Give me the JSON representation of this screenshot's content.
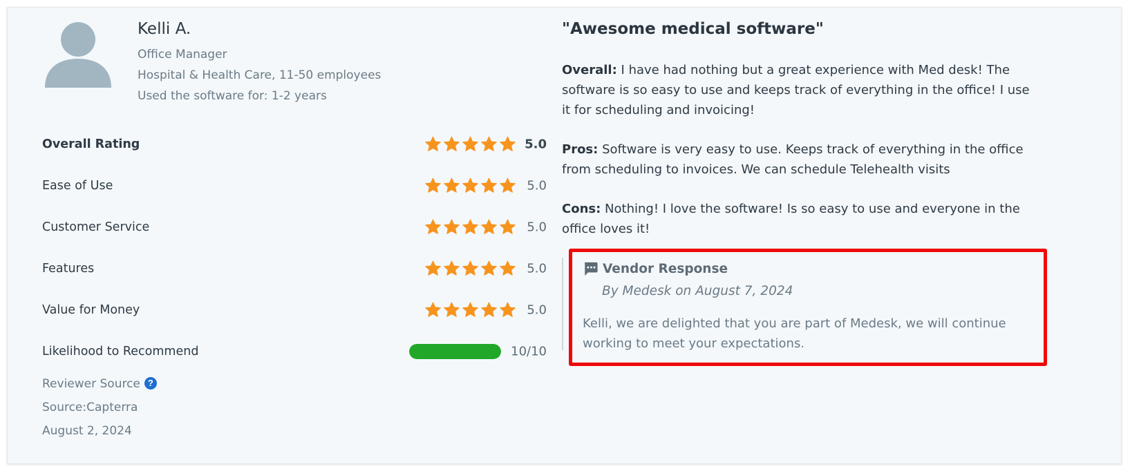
{
  "reviewer": {
    "name": "Kelli A.",
    "role": "Office Manager",
    "company": "Hospital & Health Care, 11-50 employees",
    "usage": "Used the software for: 1-2 years"
  },
  "ratings": [
    {
      "label": "Overall Rating",
      "stars": 5,
      "score": "5.0",
      "bold": true
    },
    {
      "label": "Ease of Use",
      "stars": 5,
      "score": "5.0",
      "bold": false
    },
    {
      "label": "Customer Service",
      "stars": 5,
      "score": "5.0",
      "bold": false
    },
    {
      "label": "Features",
      "stars": 5,
      "score": "5.0",
      "bold": false
    },
    {
      "label": "Value for Money",
      "stars": 5,
      "score": "5.0",
      "bold": false
    }
  ],
  "recommend": {
    "label": "Likelihood to Recommend",
    "value": 10,
    "max": 10,
    "text": "10/10"
  },
  "source": {
    "label": "Reviewer Source",
    "help_icon": "question-circle-icon",
    "source_text": "Source:Capterra",
    "date": "August 2, 2024"
  },
  "review": {
    "title": "\"Awesome medical software\"",
    "overall_label": "Overall:",
    "overall_text": " I have had nothing but a great experience with Med desk! The software is so easy to use and keeps track of everything in the office! I use it for scheduling and invoicing!",
    "pros_label": "Pros:",
    "pros_text": " Software is very easy to use. Keeps track of everything in the office from scheduling to invoices. We can schedule Telehealth visits",
    "cons_label": "Cons:",
    "cons_text": " Nothing! I love the software! Is so easy to use and everyone in the office loves it!"
  },
  "vendor": {
    "heading": "Vendor Response",
    "by": "By Medesk on August 7, 2024",
    "text": "Kelli, we are delighted that you are part of Medesk, we will continue working to meet your expectations."
  },
  "colors": {
    "star": "#f7941e",
    "bar": "#22a829",
    "highlight": "#ee0a0a",
    "help_icon": "#1f6fd1"
  }
}
